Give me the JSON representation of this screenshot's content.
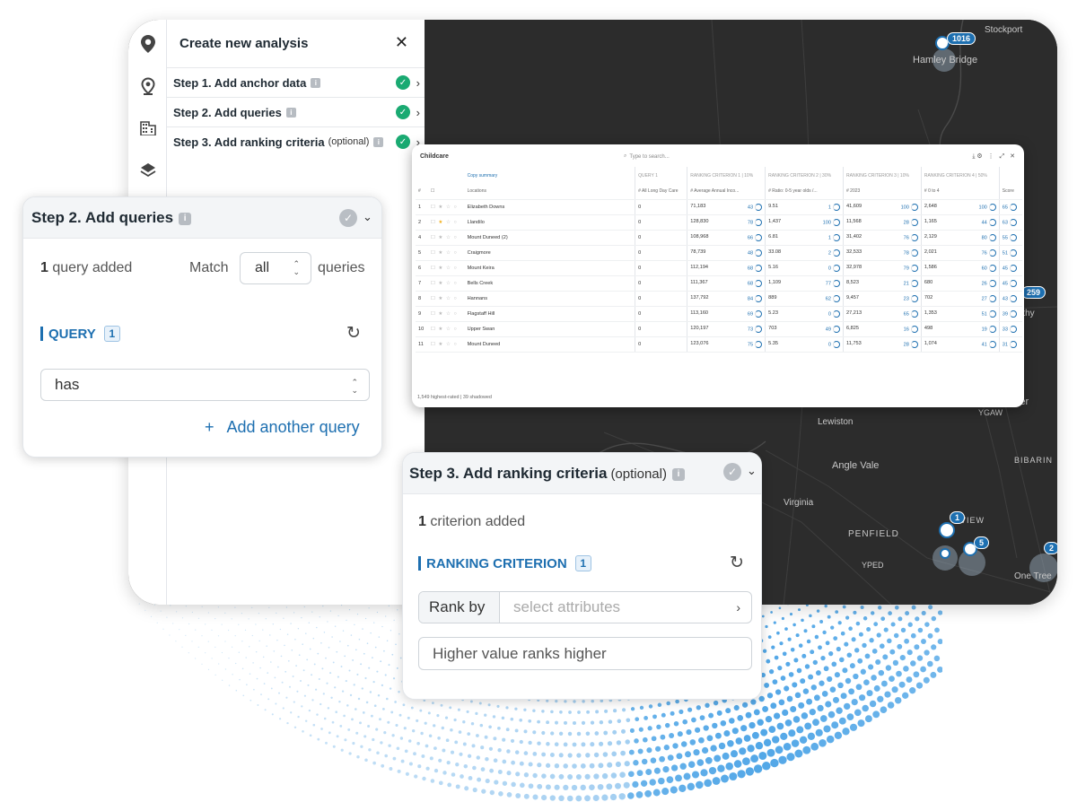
{
  "panel": {
    "title": "Create new analysis",
    "close_icon": "close-icon",
    "steps": [
      {
        "label": "Step 1. Add anchor data",
        "optional": ""
      },
      {
        "label": "Step 2. Add queries",
        "optional": ""
      },
      {
        "label": "Step 3. Add ranking criteria",
        "optional": "(optional)"
      }
    ]
  },
  "rail": {
    "icons": [
      "location-pin-icon",
      "location-pin-outline-icon",
      "building-icon",
      "layers-icon"
    ]
  },
  "map": {
    "labels": [
      "Stockport",
      "Hamley Bridge",
      "Lewiston",
      "Angle Vale",
      "Virginia",
      "PENFIELD",
      "YPED",
      "BIBARIN",
      "YGAW",
      "One Tree",
      "VIEW",
      "rthy",
      "ler"
    ],
    "badges": [
      "1016",
      "259",
      "1",
      "5",
      "2"
    ]
  },
  "table": {
    "title": "Childcare",
    "search_placeholder": "Type to search...",
    "copy_summary": "Copy summary",
    "group_headers": [
      "QUERY 1",
      "RANKING CRITERION 1 | 10%",
      "RANKING CRITERION 2 | 30%",
      "RANKING CRITERION 3 | 10%",
      "RANKING CRITERION 4 | 50%"
    ],
    "columns": [
      "#",
      "Locations",
      "# All Long Day Care",
      "# Average Annual Inco...",
      "# Ratio: 0-5 year olds /...",
      "# 2023",
      "# 0 to 4",
      "Score"
    ],
    "rows": [
      {
        "n": "1",
        "loc": "Elizabeth Downs",
        "q": "0",
        "c1": "71,183",
        "s1": "43",
        "c2": "9.51",
        "s2": "1",
        "c3": "41,609",
        "s3": "100",
        "c4": "2,648",
        "s4": "100",
        "score": "65",
        "star": false
      },
      {
        "n": "2",
        "loc": "Llandilo",
        "q": "0",
        "c1": "128,830",
        "s1": "78",
        "c2": "1,437",
        "s2": "100",
        "c3": "11,568",
        "s3": "28",
        "c4": "1,165",
        "s4": "44",
        "score": "63",
        "star": true
      },
      {
        "n": "4",
        "loc": "Mount Duneed (2)",
        "q": "0",
        "c1": "108,968",
        "s1": "66",
        "c2": "6.81",
        "s2": "1",
        "c3": "31,402",
        "s3": "76",
        "c4": "2,129",
        "s4": "80",
        "score": "55",
        "star": false
      },
      {
        "n": "5",
        "loc": "Craigmore",
        "q": "0",
        "c1": "78,739",
        "s1": "48",
        "c2": "33.08",
        "s2": "2",
        "c3": "32,533",
        "s3": "78",
        "c4": "2,021",
        "s4": "76",
        "score": "51",
        "star": false
      },
      {
        "n": "6",
        "loc": "Mount Keira",
        "q": "0",
        "c1": "112,194",
        "s1": "68",
        "c2": "5.16",
        "s2": "0",
        "c3": "32,978",
        "s3": "79",
        "c4": "1,586",
        "s4": "60",
        "score": "45",
        "star": false
      },
      {
        "n": "7",
        "loc": "Bells Creek",
        "q": "0",
        "c1": "111,367",
        "s1": "68",
        "c2": "1,109",
        "s2": "77",
        "c3": "8,523",
        "s3": "21",
        "c4": "680",
        "s4": "26",
        "score": "45",
        "star": false
      },
      {
        "n": "8",
        "loc": "Hannans",
        "q": "0",
        "c1": "137,792",
        "s1": "84",
        "c2": "889",
        "s2": "62",
        "c3": "9,457",
        "s3": "23",
        "c4": "702",
        "s4": "27",
        "score": "43",
        "star": false
      },
      {
        "n": "9",
        "loc": "Flagstaff Hill",
        "q": "0",
        "c1": "113,160",
        "s1": "69",
        "c2": "5.23",
        "s2": "0",
        "c3": "27,213",
        "s3": "65",
        "c4": "1,353",
        "s4": "51",
        "score": "39",
        "star": false
      },
      {
        "n": "10",
        "loc": "Upper Swan",
        "q": "0",
        "c1": "120,197",
        "s1": "73",
        "c2": "703",
        "s2": "49",
        "c3": "6,825",
        "s3": "16",
        "c4": "498",
        "s4": "19",
        "score": "33",
        "star": false
      },
      {
        "n": "11",
        "loc": "Mount Duneed",
        "q": "0",
        "c1": "123,076",
        "s1": "75",
        "c2": "5.35",
        "s2": "0",
        "c3": "11,753",
        "s3": "28",
        "c4": "1,074",
        "s4": "41",
        "score": "31",
        "star": false
      }
    ],
    "footer": "1,549 highest-rated | 39 shadowed"
  },
  "step2": {
    "title": "Step 2. Add queries",
    "count": "1",
    "count_suffix": "query added",
    "match_label": "Match",
    "match_value": "all",
    "queries_label": "queries",
    "query_label": "QUERY",
    "query_index": "1",
    "has_value": "has",
    "add_plus": "+",
    "add_label": "Add another query"
  },
  "step3": {
    "title": "Step 3. Add ranking criteria",
    "optional": "(optional)",
    "count": "1",
    "count_suffix": "criterion added",
    "criterion_label": "RANKING CRITERION",
    "criterion_index": "1",
    "rank_by": "Rank by",
    "attr_placeholder": "select attributes",
    "order_value": "Higher value ranks higher"
  },
  "colors": {
    "accent": "#1d6fb0",
    "success": "#1aaa72",
    "map": "#2c2c2c"
  }
}
